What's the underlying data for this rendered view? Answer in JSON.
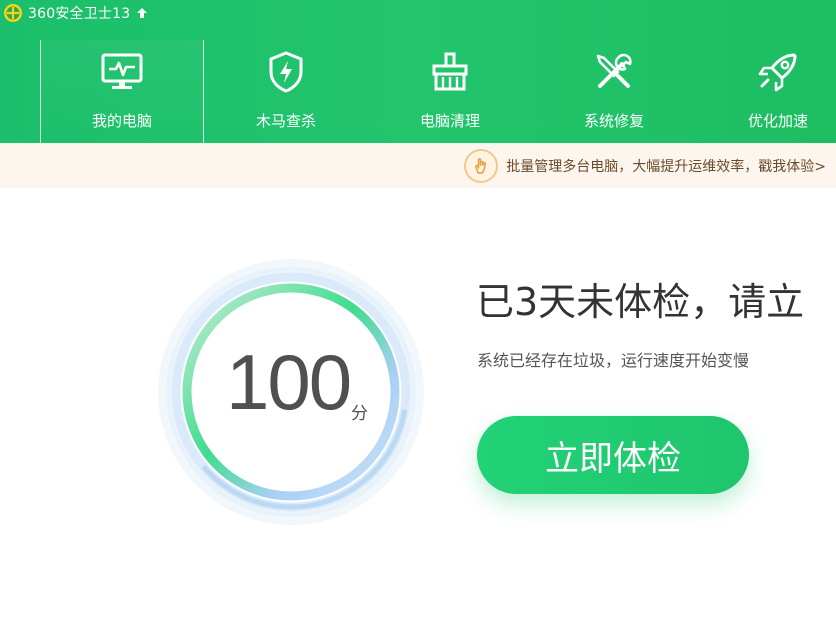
{
  "app": {
    "title": "360安全卫士13"
  },
  "nav": {
    "items": [
      {
        "label": "我的电脑",
        "icon": "monitor-pulse-icon",
        "active": true
      },
      {
        "label": "木马查杀",
        "icon": "shield-bolt-icon",
        "active": false
      },
      {
        "label": "电脑清理",
        "icon": "broom-icon",
        "active": false
      },
      {
        "label": "系统修复",
        "icon": "wrench-screwdriver-icon",
        "active": false
      },
      {
        "label": "优化加速",
        "icon": "rocket-icon",
        "active": false
      }
    ]
  },
  "promo": {
    "text": "批量管理多台电脑，大幅提升运维效率，戳我体验>",
    "icon": "hand-pointer-icon"
  },
  "score": {
    "value": "100",
    "unit": "分"
  },
  "status": {
    "headline": "已3天未体检，请立",
    "subline": "系统已经存在垃圾，运行速度开始变慢"
  },
  "actions": {
    "check_label": "立即体检"
  },
  "colors": {
    "header_green": "#1fc16a",
    "button_green": "#22d276",
    "promo_bg": "#fdf6ee",
    "ring_blue": "#a9d3f2"
  }
}
